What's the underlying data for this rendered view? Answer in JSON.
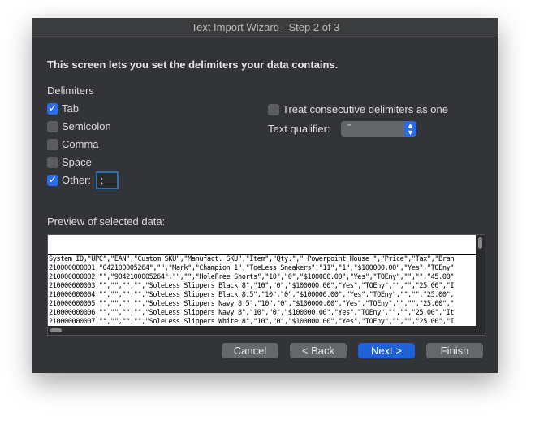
{
  "window": {
    "title": "Text Import Wizard - Step 2 of 3"
  },
  "intro": "This screen lets you set the delimiters your data contains.",
  "delimiters": {
    "heading": "Delimiters",
    "items": [
      {
        "label": "Tab",
        "checked": true
      },
      {
        "label": "Semicolon",
        "checked": false
      },
      {
        "label": "Comma",
        "checked": false
      },
      {
        "label": "Space",
        "checked": false
      },
      {
        "label": "Other:",
        "checked": true
      }
    ],
    "other_value": ";"
  },
  "options": {
    "consecutive_label": "Treat consecutive delimiters as one",
    "consecutive_checked": false,
    "qualifier_label": "Text qualifier:",
    "qualifier_value": "\""
  },
  "preview": {
    "label": "Preview of selected data:",
    "rows": [
      "System ID,\"UPC\",\"EAN\",\"Custom SKU\",\"Manufact. SKU\",\"Item\",\"Qty.\",\" Powerpoint House \",\"Price\",\"Tax\",\"Bran",
      "210000000001,\"042100005264\",\"\",\"Mark\",\"Champion 1\",\"ToeLess Sneakers\",\"11\",\"1\",\"$100000.00\",\"Yes\",\"TOEny\"",
      "210000000002,\"\",\"9042100005264\",\"\",\"\",\"HoleFree Shorts\",\"10\",\"0\",\"$100000.00\",\"Yes\",\"TOEny\",\"\",\"\",\"45.00\"",
      "210000000003,\"\",\"\",\"\",\"\",\"SoleLess Slippers Black 8\",\"10\",\"0\",\"$100000.00\",\"Yes\",\"TOEny\",\"\",\"\",\"25.00\",\"I",
      "210000000004,\"\",\"\",\"\",\"\",\"SoleLess Slippers Black 8.5\",\"10\",\"0\",\"$100000.00\",\"Yes\",\"TOEny\",\"\",\"\",\"25.00\",",
      "210000000005,\"\",\"\",\"\",\"\",\"SoleLess Slippers Navy 8.5\",\"10\",\"0\",\"$100000.00\",\"Yes\",\"TOEny\",\"\",\"\",\"25.00\",\"",
      "210000000006,\"\",\"\",\"\",\"\",\"SoleLess Slippers Navy 8\",\"10\",\"0\",\"$100000.00\",\"Yes\",\"TOEny\",\"\",\"\",\"25.00\",\"It",
      "210000000007,\"\",\"\",\"\",\"\",\"SoleLess Slippers White 8\",\"10\",\"0\",\"$100000.00\",\"Yes\",\"TOEny\",\"\",\"\",\"25.00\",\"I"
    ]
  },
  "buttons": {
    "cancel": "Cancel",
    "back": "< Back",
    "next": "Next >",
    "finish": "Finish"
  },
  "colors": {
    "accent": "#1f62d8",
    "background": "#323437"
  }
}
